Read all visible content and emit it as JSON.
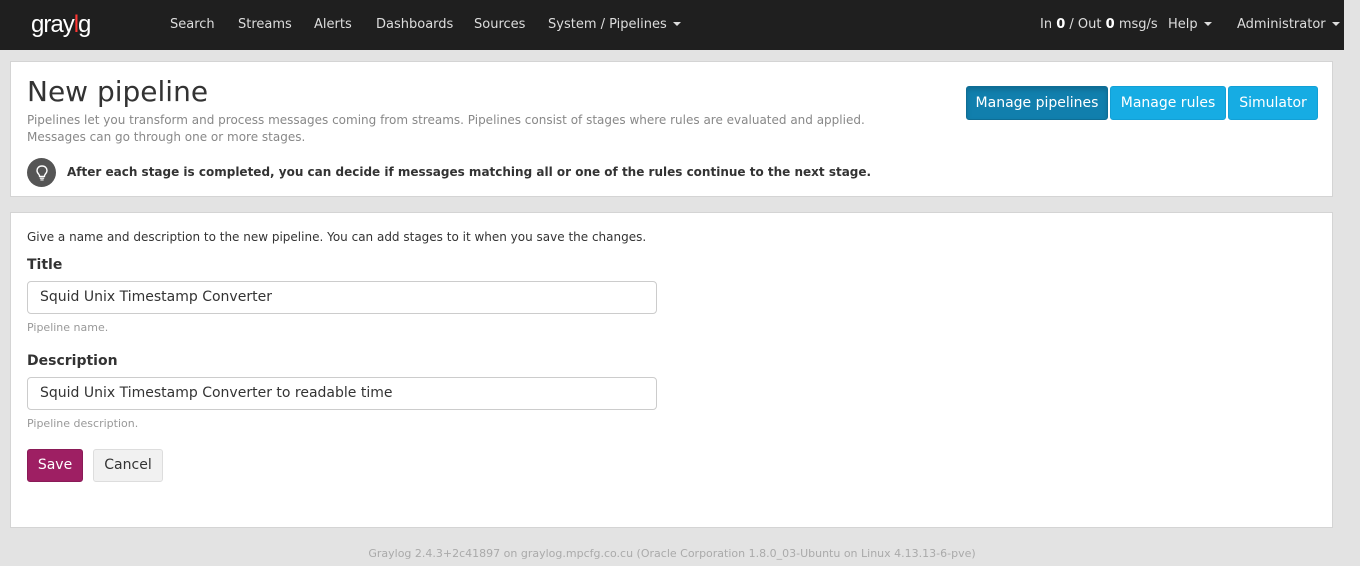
{
  "navbar": {
    "logo": {
      "left": "gray",
      "accent": "l",
      "right": "g"
    },
    "items": [
      {
        "label": "Search"
      },
      {
        "label": "Streams"
      },
      {
        "label": "Alerts"
      },
      {
        "label": "Dashboards"
      },
      {
        "label": "Sources"
      },
      {
        "label": "System / Pipelines"
      }
    ],
    "throughput": {
      "in_label": "In",
      "in_value": "0",
      "sep": " / Out ",
      "out_value": "0",
      "unit": "msg/s"
    },
    "help_label": "Help",
    "user_label": "Administrator"
  },
  "header": {
    "title": "New pipeline",
    "description": "Pipelines let you transform and process messages coming from streams. Pipelines consist of stages where rules are evaluated and applied. Messages can go through one or more stages.",
    "hint": "After each stage is completed, you can decide if messages matching all or one of the rules continue to the next stage.",
    "buttons": {
      "manage_pipelines": "Manage pipelines",
      "manage_rules": "Manage rules",
      "simulator": "Simulator"
    }
  },
  "form": {
    "intro": "Give a name and description to the new pipeline. You can add stages to it when you save the changes.",
    "title_label": "Title",
    "title_value": "Squid Unix Timestamp Converter",
    "title_help": "Pipeline name.",
    "description_label": "Description",
    "description_value": "Squid Unix Timestamp Converter to readable time",
    "description_help": "Pipeline description.",
    "save_label": "Save",
    "cancel_label": "Cancel"
  },
  "footer": {
    "text": "Graylog 2.4.3+2c41897 on graylog.mpcfg.co.cu (Oracle Corporation 1.8.0_03-Ubuntu on Linux 4.13.13-6-pve)"
  },
  "colors": {
    "navbar_bg": "#1f1f1f",
    "logo_accent": "#ff3633",
    "info_button": "#16ace3",
    "info_button_active": "#117fad",
    "primary_button": "#9e1f63"
  }
}
